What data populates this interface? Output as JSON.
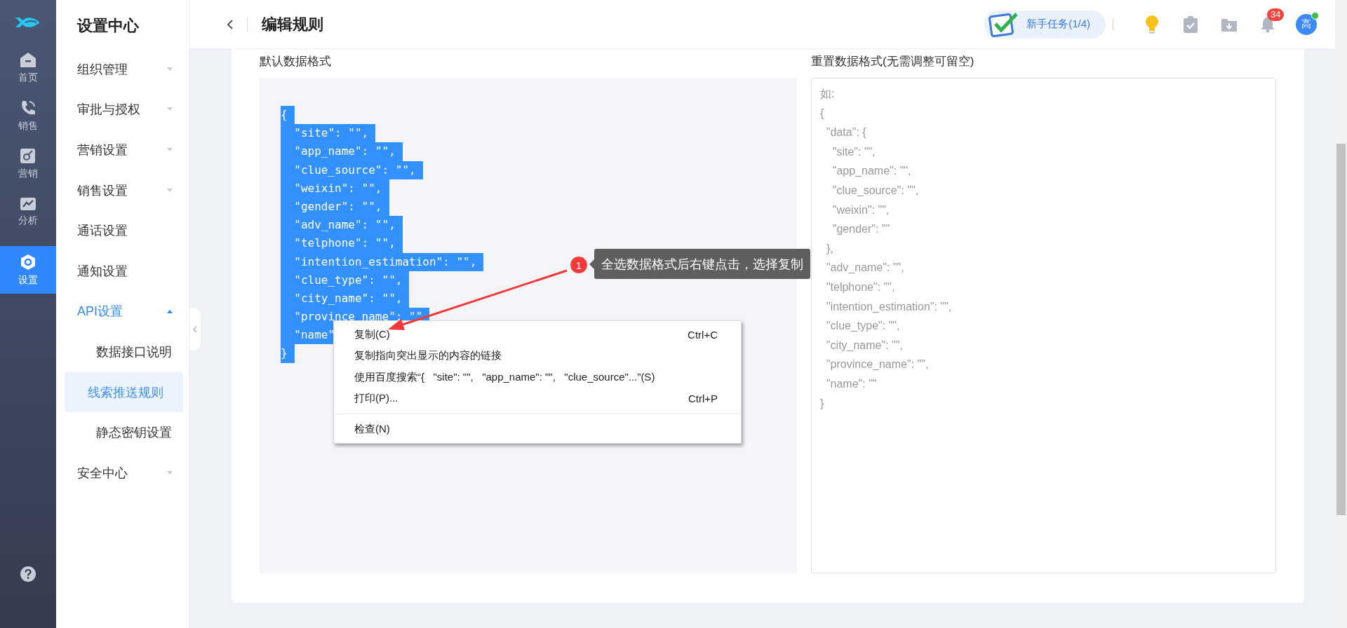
{
  "rail": {
    "items": [
      {
        "label": "首页",
        "selected": false
      },
      {
        "label": "销售",
        "selected": false
      },
      {
        "label": "营销",
        "selected": false
      },
      {
        "label": "分析",
        "selected": false
      },
      {
        "label": "设置",
        "selected": true
      }
    ]
  },
  "sidebar": {
    "title": "设置中心",
    "items": [
      {
        "label": "组织管理",
        "kind": "group",
        "expanded": false
      },
      {
        "label": "审批与授权",
        "kind": "group",
        "expanded": false
      },
      {
        "label": "营销设置",
        "kind": "group",
        "expanded": false
      },
      {
        "label": "销售设置",
        "kind": "group",
        "expanded": false
      },
      {
        "label": "通话设置",
        "kind": "link"
      },
      {
        "label": "通知设置",
        "kind": "link"
      },
      {
        "label": "API设置",
        "kind": "group",
        "expanded": true,
        "children": [
          {
            "label": "数据接口说明",
            "selected": false
          },
          {
            "label": "线索推送规则",
            "selected": true
          },
          {
            "label": "静态密钥设置",
            "selected": false
          }
        ]
      },
      {
        "label": "安全中心",
        "kind": "group",
        "expanded": false
      }
    ]
  },
  "header": {
    "title": "编辑规则",
    "task_button": "新手任务(1/4)",
    "notification_count": "34",
    "avatar": {
      "text": "高",
      "online": true
    }
  },
  "default_format": {
    "label": "默认数据格式",
    "lines": [
      {
        "text": "{",
        "selected": true
      },
      {
        "text": "  \"site\": \"\",",
        "selected": true
      },
      {
        "text": "  \"app_name\": \"\",",
        "selected": true
      },
      {
        "text": "  \"clue_source\": \"\",",
        "selected": true
      },
      {
        "text": "  \"weixin\": \"\",",
        "selected": true
      },
      {
        "text": "  \"gender\": \"\",",
        "selected": true
      },
      {
        "text": "  \"adv_name\": \"\",",
        "selected": true
      },
      {
        "text": "  \"telphone\": \"\",",
        "selected": true
      },
      {
        "text": "  \"intention_estimation\": \"\",",
        "selected": true
      },
      {
        "text": "  \"clue_type\": \"\",",
        "selected": true
      },
      {
        "text": "  \"city_name\": \"\",",
        "selected": true
      },
      {
        "text": "  \"province_name\": \"\"",
        "selected": true
      },
      {
        "text": "  \"name\"",
        "selected": true
      },
      {
        "text": "}",
        "selected": true
      }
    ]
  },
  "custom_format": {
    "label": "重置数据格式(无需调整可留空)",
    "placeholder": "如:\n{\n  \"data\": {\n    \"site\": \"\",\n    \"app_name\": \"\",\n    \"clue_source\": \"\",\n    \"weixin\": \"\",\n    \"gender\": \"\"\n  },\n  \"adv_name\": \"\",\n  \"telphone\": \"\",\n  \"intention_estimation\": \"\",\n  \"clue_type\": \"\",\n  \"city_name\": \"\",\n  \"province_name\": \"\",\n  \"name\": \"\"\n}"
  },
  "context_menu": {
    "items": [
      {
        "kind": "item",
        "label": "复制(C)",
        "shortcut": "Ctrl+C"
      },
      {
        "kind": "item",
        "label": "复制指向突出显示的内容的链接"
      },
      {
        "kind": "item",
        "label": "使用百度搜索“{   \"site\": \"\",   \"app_name\": \"\",   \"clue_source\"...”(S)"
      },
      {
        "kind": "item",
        "label": "打印(P)...",
        "shortcut": "Ctrl+P"
      },
      {
        "kind": "separator"
      },
      {
        "kind": "item",
        "label": "检查(N)"
      }
    ]
  },
  "annotation": {
    "number": "1",
    "text": "全选数据格式后右键点击，选择复制"
  }
}
